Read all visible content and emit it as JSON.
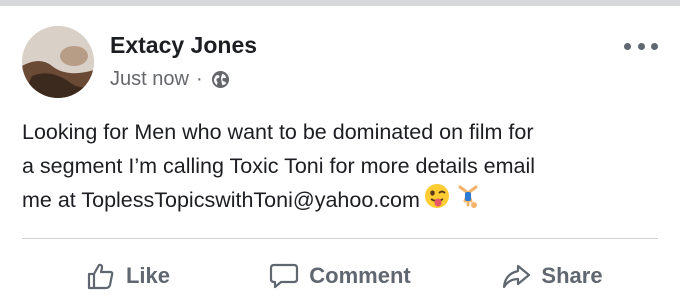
{
  "post": {
    "author": "Extacy Jones",
    "timestamp": "Just now",
    "separator": "·",
    "privacy_icon": "globe-icon",
    "menu_icon": "more-horizontal-icon",
    "text_lines": [
      "Looking for Men who want to be dominated on film for",
      "a segment I’m calling Toxic Toni for more details email",
      "me at ToplessTopicswithToni@yahoo.com"
    ],
    "emojis": [
      "winking-face-with-tongue-emoji",
      "cartwheel-person-emoji"
    ]
  },
  "actions": {
    "like": "Like",
    "comment": "Comment",
    "share": "Share"
  },
  "colors": {
    "text": "#1c1e21",
    "secondary": "#65676b",
    "action": "#606770",
    "divider": "#ced0d4"
  }
}
